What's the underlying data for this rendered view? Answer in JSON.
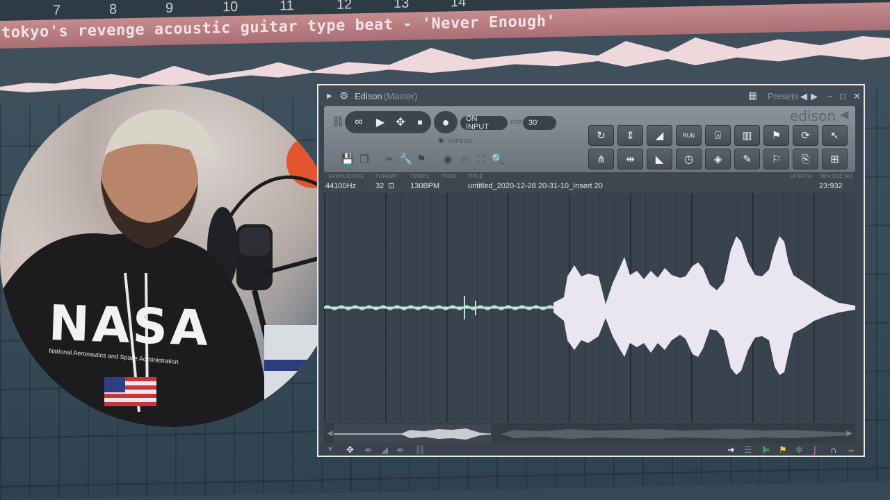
{
  "playlist": {
    "ruler_numbers": [
      "7",
      "8",
      "9",
      "10",
      "11",
      "12",
      "13",
      "14"
    ],
    "clip_title": "tokyo's revenge acoustic guitar type beat - 'Never Enough'"
  },
  "webcam": {
    "shirt_text": "NASA",
    "shirt_subtext": "National Aeronautics and Space Administration"
  },
  "edison": {
    "title": "Edison",
    "title_suffix": "(Master)",
    "presets_label": "Presets",
    "logo_text": "edison",
    "record_mode": "ON INPUT",
    "for_label": "FOR",
    "duration": "30'",
    "append_label": "APPEND",
    "run_label": "RUN",
    "info": {
      "samplerate_label": "SAMPLERATE",
      "samplerate": "44100Hz",
      "format_label": "FORMAT",
      "format": "32",
      "tempo_label": "TEMPO",
      "tempo": "130BPM",
      "free_label": "FREE",
      "title_label": "TITLE",
      "title": "untitled_2020-12-28 20-31-10_Insert 20",
      "length_label": "LENGTH",
      "minsecms_label": "MIN:SEC:MS",
      "length": "23:932"
    },
    "colors": {
      "waveform": "#e9e6ef",
      "waveform_quiet": "#b9e6d8",
      "accent_yellow": "#f5d33a",
      "accent_green": "#5fd0a0",
      "accent_pink": "#e06cc2"
    }
  }
}
